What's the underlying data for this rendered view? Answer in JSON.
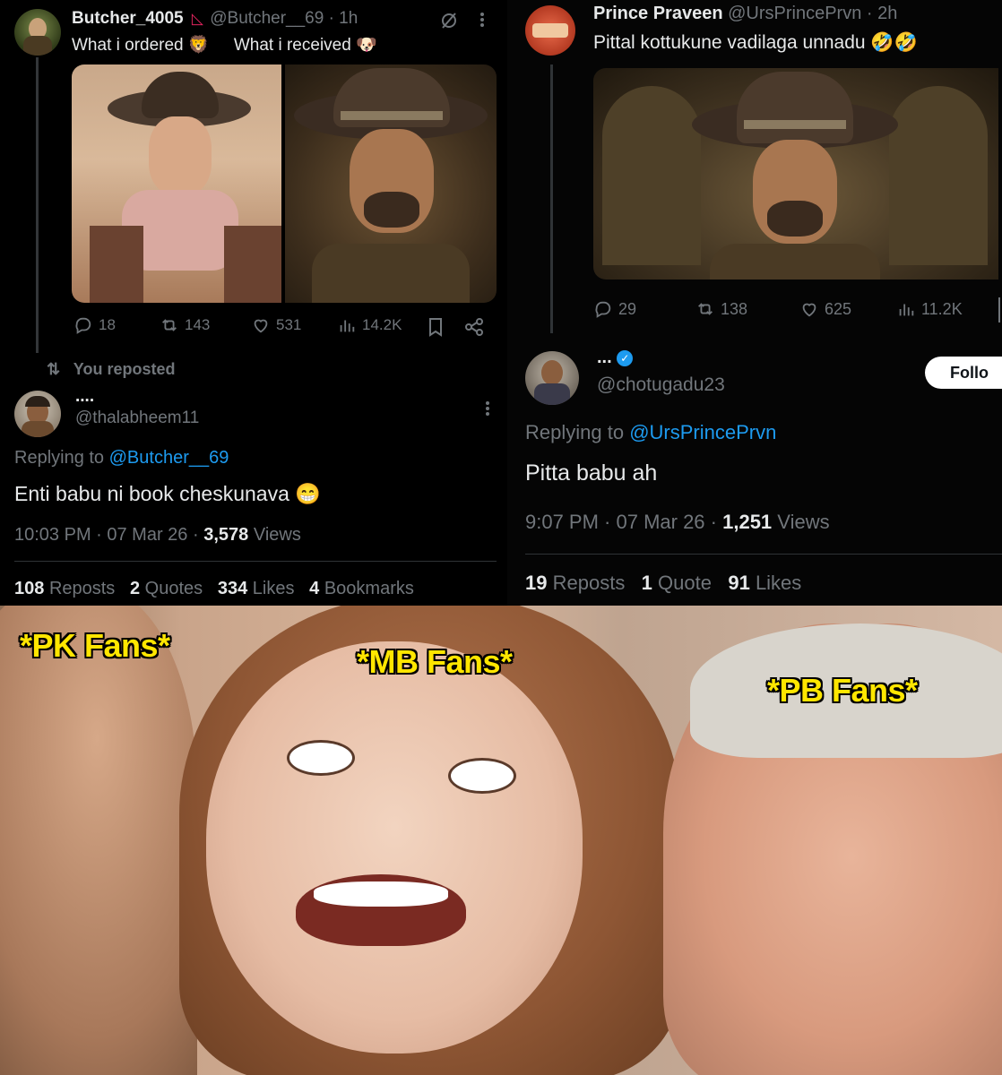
{
  "left": {
    "tweet": {
      "display_name": "Butcher_4005",
      "handle": "@Butcher__69 · 1h",
      "text_a": "What i ordered",
      "text_b": "What i received",
      "emoji_a": "🦁",
      "emoji_b": "🐶",
      "images": [
        "cowboy-young-man-photo",
        "cowboy-older-man-photo"
      ],
      "replies": "18",
      "reposts": "143",
      "likes": "531",
      "views": "14.2K"
    },
    "repost_note": "You reposted",
    "reply": {
      "display_name": "....",
      "handle": "@thalabheem11",
      "replying_prefix": "Replying to",
      "replying_to": "@Butcher__69",
      "text": "Enti babu ni book cheskunava 😁",
      "time": "10:03 PM · 07 Mar 26 ·",
      "views_count": "3,578",
      "views_label": "Views",
      "reposts_count": "108",
      "reposts_label": "Reposts",
      "quotes_count": "2",
      "quotes_label": "Quotes",
      "likes_count": "334",
      "likes_label": "Likes",
      "bookmarks_count": "4",
      "bookmarks_label": "Bookmarks"
    }
  },
  "right": {
    "tweet": {
      "display_name": "Prince Praveen",
      "handle": "@UrsPrincePrvn · 2h",
      "text": "Pittal kottukune vadilaga unnadu 🤣🤣",
      "image": "cowboy-older-man-photo",
      "replies": "29",
      "reposts": "138",
      "likes": "625",
      "views": "11.2K"
    },
    "reply": {
      "display_name": "...",
      "handle": "@chotugadu23",
      "follow_label": "Follo",
      "replying_prefix": "Replying to",
      "replying_to": "@UrsPrincePrvn",
      "text": "Pitta babu ah",
      "time": "9:07 PM · 07 Mar 26 ·",
      "views_count": "1,251",
      "views_label": "Views",
      "reposts_count": "19",
      "reposts_label": "Reposts",
      "quotes_count": "1",
      "quotes_label": "Quote",
      "likes_count": "91",
      "likes_label": "Likes"
    }
  },
  "meme": {
    "caption_left": "*PK Fans*",
    "caption_center": "*MB Fans*",
    "caption_right": "*PB Fans*"
  },
  "colors": {
    "background": "#000000",
    "text": "#e7e9ea",
    "muted": "#71767b",
    "link": "#1d9bf0",
    "caption": "#ffe600"
  }
}
